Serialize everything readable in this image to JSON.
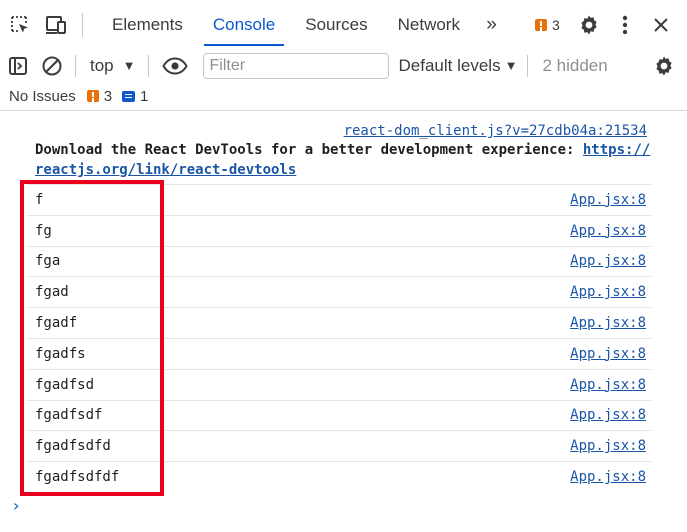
{
  "tabs": {
    "items": [
      {
        "label": "Elements",
        "active": false
      },
      {
        "label": "Console",
        "active": true
      },
      {
        "label": "Sources",
        "active": false
      },
      {
        "label": "Network",
        "active": false
      }
    ],
    "more_symbol": "»",
    "issues_count": "3"
  },
  "toolbar": {
    "context": "top",
    "filter_placeholder": "Filter",
    "levels": "Default levels",
    "hidden": "2 hidden"
  },
  "issues_bar": {
    "label": "No Issues",
    "warnings": "3",
    "infos": "1"
  },
  "console": {
    "devtools_message": {
      "source": "react-dom_client.js?v=27cdb04a:21534",
      "text": "Download the React DevTools for a better development experience: ",
      "link": "https://reactjs.org/link/react-devtools"
    },
    "logs": [
      {
        "text": "f",
        "source": "App.jsx:8"
      },
      {
        "text": "fg",
        "source": "App.jsx:8"
      },
      {
        "text": "fga",
        "source": "App.jsx:8"
      },
      {
        "text": "fgad",
        "source": "App.jsx:8"
      },
      {
        "text": "fgadf",
        "source": "App.jsx:8"
      },
      {
        "text": "fgadfs",
        "source": "App.jsx:8"
      },
      {
        "text": "fgadfsd",
        "source": "App.jsx:8"
      },
      {
        "text": "fgadfsdf",
        "source": "App.jsx:8"
      },
      {
        "text": "fgadfsdfd",
        "source": "App.jsx:8"
      },
      {
        "text": "fgadfsdfdf",
        "source": "App.jsx:8"
      }
    ],
    "prompt_symbol": "›"
  },
  "colors": {
    "accent": "#0b57d0",
    "warning": "#e8710a",
    "highlight_box": "#e8001e",
    "link": "#1a55a8"
  },
  "icons": [
    "inspect-element-icon",
    "device-toolbar-icon",
    "settings-gear-icon",
    "more-vert-icon",
    "close-icon",
    "sidebar-toggle-icon",
    "clear-console-icon",
    "eye-icon",
    "console-settings-gear-icon"
  ]
}
